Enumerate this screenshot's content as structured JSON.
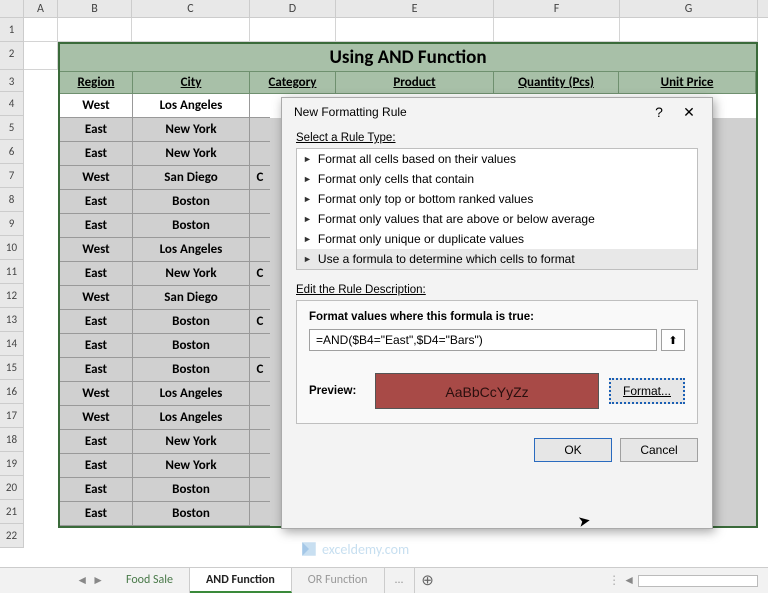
{
  "columns": [
    "A",
    "B",
    "C",
    "D",
    "E",
    "F",
    "G"
  ],
  "row_numbers": [
    1,
    2,
    3,
    4,
    5,
    6,
    7,
    8,
    9,
    10,
    11,
    12,
    13,
    14,
    15,
    16,
    17,
    18,
    19,
    20,
    21,
    22
  ],
  "table": {
    "title": "Using AND Function",
    "headers": [
      "Region",
      "City",
      "Category",
      "Product",
      "Quantity (Pcs)",
      "Unit Price"
    ],
    "rows": [
      {
        "region": "West",
        "city": "Los Angeles",
        "catcut": ""
      },
      {
        "region": "East",
        "city": "New York",
        "catcut": ""
      },
      {
        "region": "East",
        "city": "New York",
        "catcut": ""
      },
      {
        "region": "West",
        "city": "San Diego",
        "catcut": "C"
      },
      {
        "region": "East",
        "city": "Boston",
        "catcut": ""
      },
      {
        "region": "East",
        "city": "Boston",
        "catcut": ""
      },
      {
        "region": "West",
        "city": "Los Angeles",
        "catcut": ""
      },
      {
        "region": "East",
        "city": "New York",
        "catcut": "C"
      },
      {
        "region": "West",
        "city": "San Diego",
        "catcut": ""
      },
      {
        "region": "East",
        "city": "Boston",
        "catcut": "C"
      },
      {
        "region": "East",
        "city": "Boston",
        "catcut": ""
      },
      {
        "region": "East",
        "city": "Boston",
        "catcut": "C"
      },
      {
        "region": "West",
        "city": "Los Angeles",
        "catcut": ""
      },
      {
        "region": "West",
        "city": "Los Angeles",
        "catcut": ""
      },
      {
        "region": "East",
        "city": "New York",
        "catcut": ""
      },
      {
        "region": "East",
        "city": "New York",
        "catcut": ""
      },
      {
        "region": "East",
        "city": "Boston",
        "catcut": ""
      },
      {
        "region": "East",
        "city": "Boston",
        "catcut": ""
      }
    ]
  },
  "dialog": {
    "title": "New Formatting Rule",
    "help": "?",
    "close": "✕",
    "select_label": "Select a Rule Type:",
    "rule_types": [
      "Format all cells based on their values",
      "Format only cells that contain",
      "Format only top or bottom ranked values",
      "Format only values that are above or below average",
      "Format only unique or duplicate values",
      "Use a formula to determine which cells to format"
    ],
    "edit_label": "Edit the Rule Description:",
    "formula_label": "Format values where this formula is true:",
    "formula_value": "=AND($B4=\"East\",$D4=\"Bars\")",
    "preview_label": "Preview:",
    "preview_text": "AaBbCcYyZz",
    "format_btn": "Format...",
    "ok": "OK",
    "cancel": "Cancel",
    "ref_icon": "⬆"
  },
  "tabs": {
    "items": [
      "Food Sale",
      "AND Function",
      "OR Function"
    ],
    "more": "...",
    "add": "⊕"
  },
  "watermark": "exceldemy.com"
}
